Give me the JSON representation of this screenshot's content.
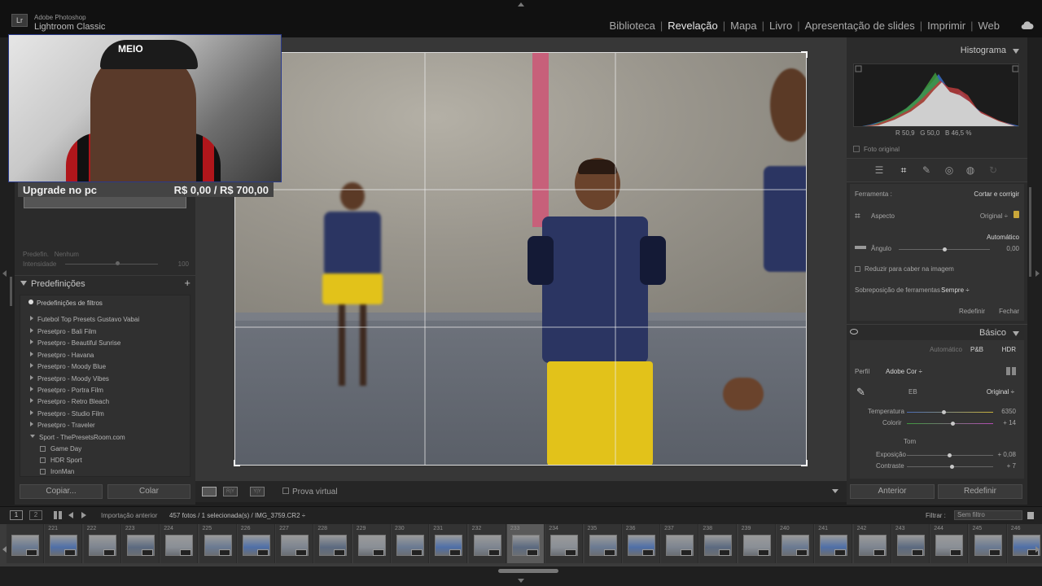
{
  "app": {
    "line1": "Adobe Photoshop",
    "line2": "Lightroom Classic",
    "badge": "Lr"
  },
  "modules": [
    "Biblioteca",
    "Revelação",
    "Mapa",
    "Livro",
    "Apresentação de slides",
    "Imprimir",
    "Web"
  ],
  "active_module": "Revelação",
  "overlay": {
    "logo": "MEIO",
    "promo_title": "Upgrade no pc",
    "promo_price": "R$ 0,00 / R$ 700,00"
  },
  "left_panel": {
    "preset_label": "Predefin.",
    "preset_value": "Nenhum",
    "intensity_label": "Intensidade",
    "intensity_value": "100",
    "intensity_fraction": 0.56,
    "presets_title": "Predefinições",
    "presets_add": "+",
    "filter_label": "Predefinições de filtros",
    "items": [
      "Futebol Top Presets Gustavo Vabai",
      "Presetpro - Bali Film",
      "Presetpro - Beautiful Sunrise",
      "Presetpro - Havana",
      "Presetpro - Moody Blue",
      "Presetpro - Moody Vibes",
      "Presetpro - Portra Film",
      "Presetpro - Retro Bleach",
      "Presetpro - Studio Film",
      "Presetpro - Traveler"
    ],
    "open_group": "Sport - ThePresetsRoom.com",
    "sub_items": [
      "Game Day",
      "HDR Sport",
      "IronMan"
    ],
    "copy_button": "Copiar...",
    "paste_button": "Colar"
  },
  "toolbar": {
    "compare_label": "R|Y",
    "survey_label": "Y|Y",
    "proof_label": "Prova virtual"
  },
  "right_panel": {
    "histogram_title": "Histograma",
    "readout": {
      "r_label": "R",
      "r": "50,9",
      "g_label": "G",
      "g": "50,0",
      "b_label": "B",
      "b": "46,5",
      "unit": "%"
    },
    "original_photo": "Foto original",
    "tool_label": "Ferramenta :",
    "tool_value": "Cortar e corrigir",
    "aspect_label": "Aspecto",
    "aspect_value": "Original ÷",
    "auto_label": "Automático",
    "angle_label": "Ângulo",
    "angle_value": "0,00",
    "constrain_label": "Reduzir para caber na imagem",
    "overlay_label": "Sobreposição de ferramentas :",
    "overlay_value": "Sempre ÷",
    "reset_label": "Redefinir",
    "close_label": "Fechar",
    "basic_title": "Básico",
    "basic_auto": "Automático",
    "basic_rgb": "P&B",
    "basic_hdr": "HDR",
    "profile_label": "Perfil",
    "profile_value": "Adobe Cor ÷",
    "wb_label": "EB",
    "wb_value": "Original ÷",
    "temp_label": "Temperatura",
    "temp_value": "6350",
    "tint_label": "Colorir",
    "tint_value": "+ 14",
    "tone_label": "Tom",
    "exposure_label": "Exposição",
    "exposure_value": "+ 0,08",
    "contrast_label": "Contraste",
    "contrast_value": "+ 7",
    "prev_button": "Anterior",
    "reset_button": "Redefinir"
  },
  "filmbar": {
    "screen1": "1",
    "screen2": "2",
    "source": "Importação anterior",
    "info": "457 fotos / 1 selecionada(s) / IMG_3759.CR2 ÷",
    "filter_label": "Filtrar :",
    "filter_value": "Sem filtro"
  },
  "filmstrip": {
    "numbers": [
      "",
      "221",
      "222",
      "223",
      "224",
      "225",
      "226",
      "227",
      "228",
      "229",
      "230",
      "231",
      "232",
      "233",
      "234",
      "235",
      "236",
      "237",
      "238",
      "239",
      "240",
      "241",
      "242",
      "243",
      "244",
      "245",
      "246"
    ],
    "selected": "233"
  },
  "colors": {
    "accent_stripe": "#c7607a",
    "shorts": "#e2c21a",
    "jersey": "#2b3562"
  }
}
